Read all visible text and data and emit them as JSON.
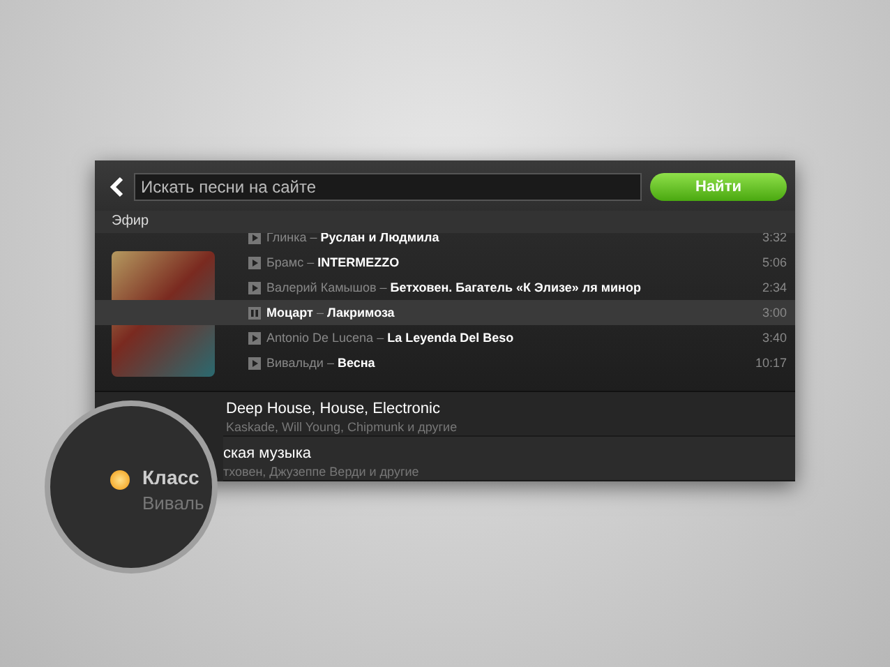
{
  "search": {
    "placeholder": "Искать песни на сайте",
    "button": "Найти"
  },
  "section_label": "Эфир",
  "separator": "–",
  "tracks": [
    {
      "artist": "Глинка",
      "title": "Руслан и Людмила",
      "duration": "3:32",
      "playing": false
    },
    {
      "artist": "Брамс",
      "title": "INTERMEZZO",
      "duration": "5:06",
      "playing": false
    },
    {
      "artist": "Валерий Камышов",
      "title": "Бетховен. Багатель «К Элизе» ля минор",
      "duration": "2:34",
      "playing": false
    },
    {
      "artist": "Моцарт",
      "title": "Лакримоза",
      "duration": "3:00",
      "playing": true
    },
    {
      "artist": "Antonio De Lucena",
      "title": "La Leyenda Del Beso",
      "duration": "3:40",
      "playing": false
    },
    {
      "artist": "Вивальди",
      "title": "Весна",
      "duration": "10:17",
      "playing": false
    }
  ],
  "stations": [
    {
      "title": "Deep House, House, Electronic",
      "subtitle": "Kaskade, Will Young, Chipmunk и другие",
      "selected": false
    },
    {
      "title": "ская музыка",
      "subtitle": "тховен, Джузеппе Верди и другие",
      "selected": true
    }
  ],
  "magnifier": {
    "title": "Класс",
    "subtitle": "Виваль"
  }
}
